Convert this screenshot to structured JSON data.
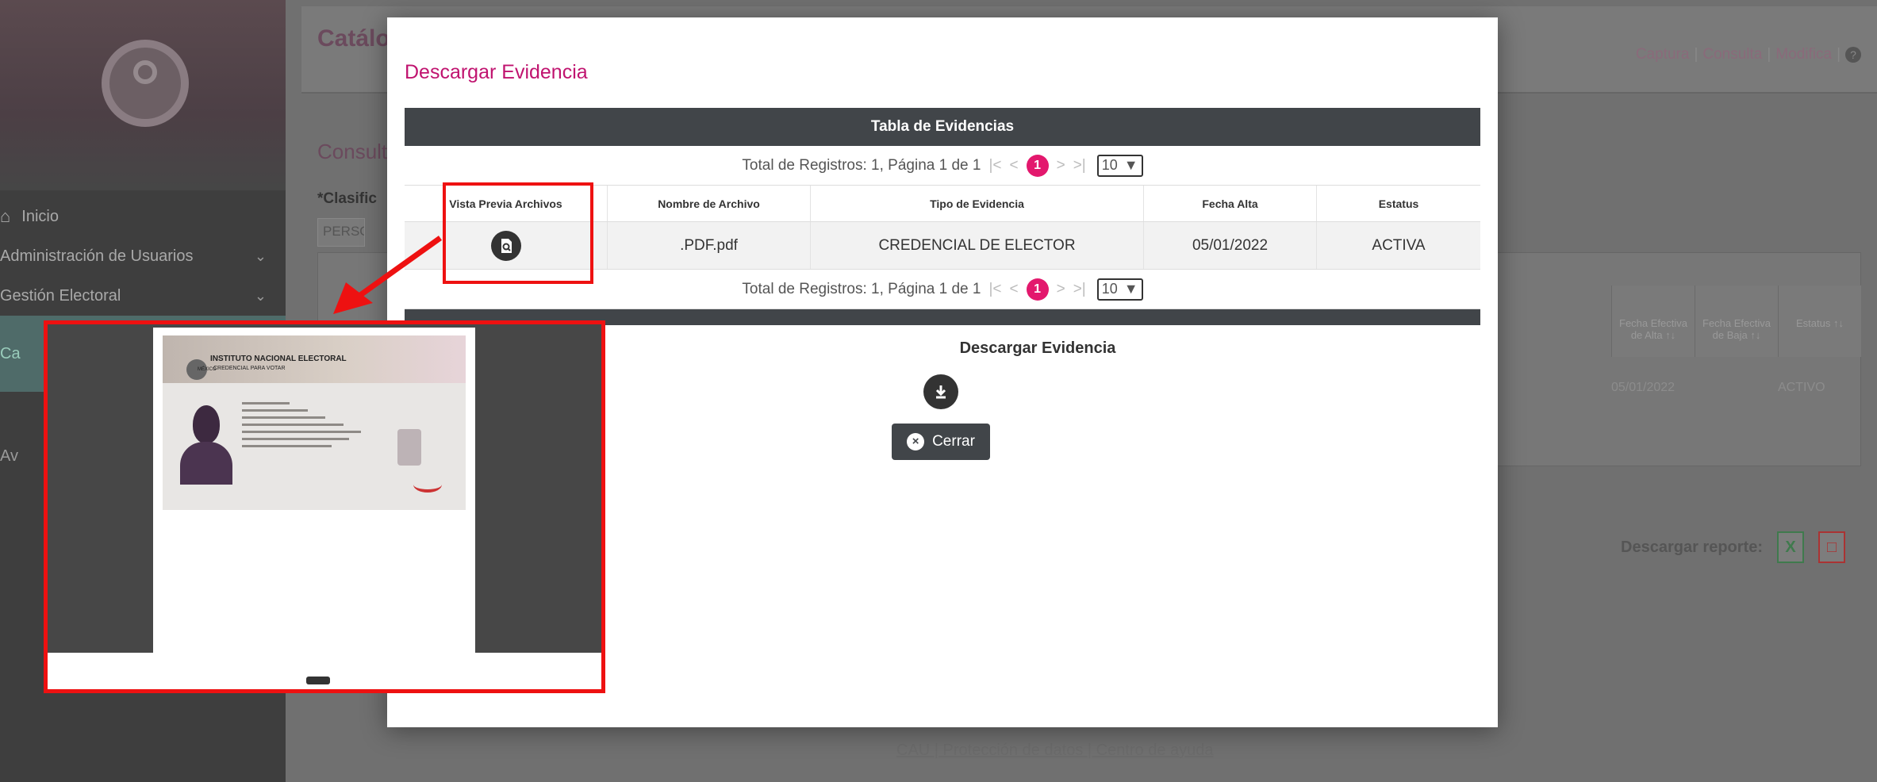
{
  "sidebar": {
    "items": [
      {
        "label": "Inicio",
        "has_icon": true
      },
      {
        "label": "Administración de Usuarios",
        "chevron": true
      },
      {
        "label": "Gestión Electoral",
        "chevron": true
      },
      {
        "label": "Ca",
        "active": true
      },
      {
        "label": "Av"
      }
    ]
  },
  "header": {
    "title": "Catálog",
    "links": [
      "Captura",
      "Consulta",
      "Modifica"
    ],
    "separators": [
      "|",
      "|",
      "|"
    ]
  },
  "background": {
    "section_title": "Consult",
    "field_label": "*Clasific",
    "field_value": "PERSON",
    "table_headers": [
      "Fecha Efectiva de Alta ↑↓",
      "Fecha Efectiva de Baja ↑↓",
      "Estatus ↑↓"
    ],
    "row_values": [
      "05/01/2022",
      "",
      "ACTIVO"
    ],
    "report_label": "Descargar reporte:",
    "footer_links": "CAU | Protección de datos | Centro de ayuda"
  },
  "modal": {
    "title": "Descargar Evidencia",
    "table_title": "Tabla de Evidencias",
    "pager": {
      "summary": "Total de Registros: 1, Página 1 de 1",
      "first": "|<",
      "prev": "<",
      "current": "1",
      "next": ">",
      "last": ">|",
      "page_size": "10"
    },
    "columns": [
      "Vista Previa Archivos",
      "Nombre de Archivo",
      "Tipo de Evidencia",
      "Fecha Alta",
      "Estatus"
    ],
    "rows": [
      {
        "file_name": ".PDF.pdf",
        "type": "CREDENCIAL DE ELECTOR",
        "date": "05/01/2022",
        "status": "ACTIVA"
      }
    ],
    "download_label": "Descargar Evidencia",
    "close_label": "Cerrar"
  },
  "preview": {
    "card_title": "INSTITUTO NACIONAL ELECTORAL",
    "card_subtitle": "CREDENCIAL PARA VOTAR",
    "card_country": "MÉXICO"
  },
  "colors": {
    "accent": "#e3186d",
    "title_pink": "#c0136f",
    "table_header": "#414549",
    "annotation_red": "#ee1111"
  }
}
